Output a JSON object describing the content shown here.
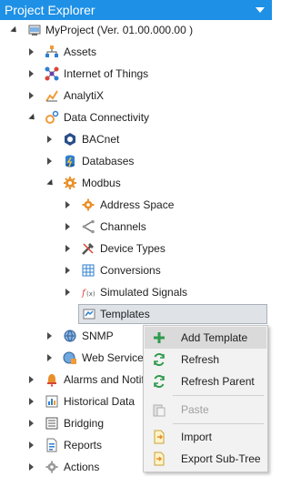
{
  "panel": {
    "title": "Project Explorer"
  },
  "tree": {
    "root": "MyProject (Ver. 01.00.000.00 )",
    "assets": "Assets",
    "iot": "Internet of Things",
    "analytix": "AnalytiX",
    "data_connectivity": "Data Connectivity",
    "bacnet": "BACnet",
    "databases": "Databases",
    "modbus": "Modbus",
    "address_space": "Address Space",
    "channels": "Channels",
    "device_types": "Device Types",
    "conversions": "Conversions",
    "simulated_signals": "Simulated Signals",
    "templates": "Templates",
    "snmp": "SNMP",
    "web_services": "Web Services",
    "alarms": "Alarms and Notif",
    "historical": "Historical Data",
    "bridging": "Bridging",
    "reports": "Reports",
    "actions": "Actions"
  },
  "context_menu": {
    "add_template": "Add Template",
    "refresh": "Refresh",
    "refresh_parent": "Refresh Parent",
    "paste": "Paste",
    "import": "Import",
    "export_subtree": "Export Sub-Tree"
  },
  "colors": {
    "accent": "#1e90e6"
  }
}
